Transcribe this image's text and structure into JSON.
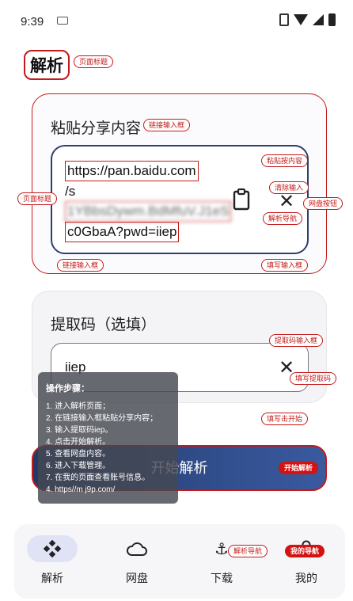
{
  "status": {
    "time": "9:39"
  },
  "header": {
    "title": "解析",
    "tag": "页面标题"
  },
  "share": {
    "label": "粘贴分享内容",
    "tag_label": "链接输入框",
    "lines": [
      "https://pan.baidu.com",
      "/s",
      "1YBbsDywm.BdMfuV.J1eS",
      "c0GbaA?pwd=iiep"
    ],
    "tags": {
      "paste": "粘贴按内容",
      "clear": "清除输入",
      "left": "页面标题",
      "nav_parse": "解析导航",
      "nav_pan": "网盘按钮",
      "bottom_left": "链接输入框",
      "bottom_right": "填写输入框"
    }
  },
  "code": {
    "label": "提取码（选填）",
    "value": "iiep",
    "tags": {
      "input": "提取码输入框",
      "fill": "填写提取码",
      "tap": "填写击开始"
    }
  },
  "start": {
    "label": "开始解析",
    "tag": "开始解析"
  },
  "steps": {
    "title": "操作步骤：",
    "lines": [
      "1. 进入解析页面；",
      "2. 在链接输入框粘贴分享内容；",
      "3. 输入提取码iep。",
      "4. 点击开始解析。",
      "5. 查看网盘内容。",
      "6. 进入下载管理。",
      "7. 在我的页面查看账号信息。",
      "4. https//m j9p.com/"
    ]
  },
  "nav": {
    "items": [
      {
        "label": "解析",
        "icon": "apps-icon"
      },
      {
        "label": "网盘",
        "icon": "cloud-icon"
      },
      {
        "label": "下载",
        "icon": "anchor-icon"
      },
      {
        "label": "我的",
        "icon": "person-icon"
      }
    ],
    "tag_parse": "解析导航",
    "tag_mine": "我的导航"
  }
}
